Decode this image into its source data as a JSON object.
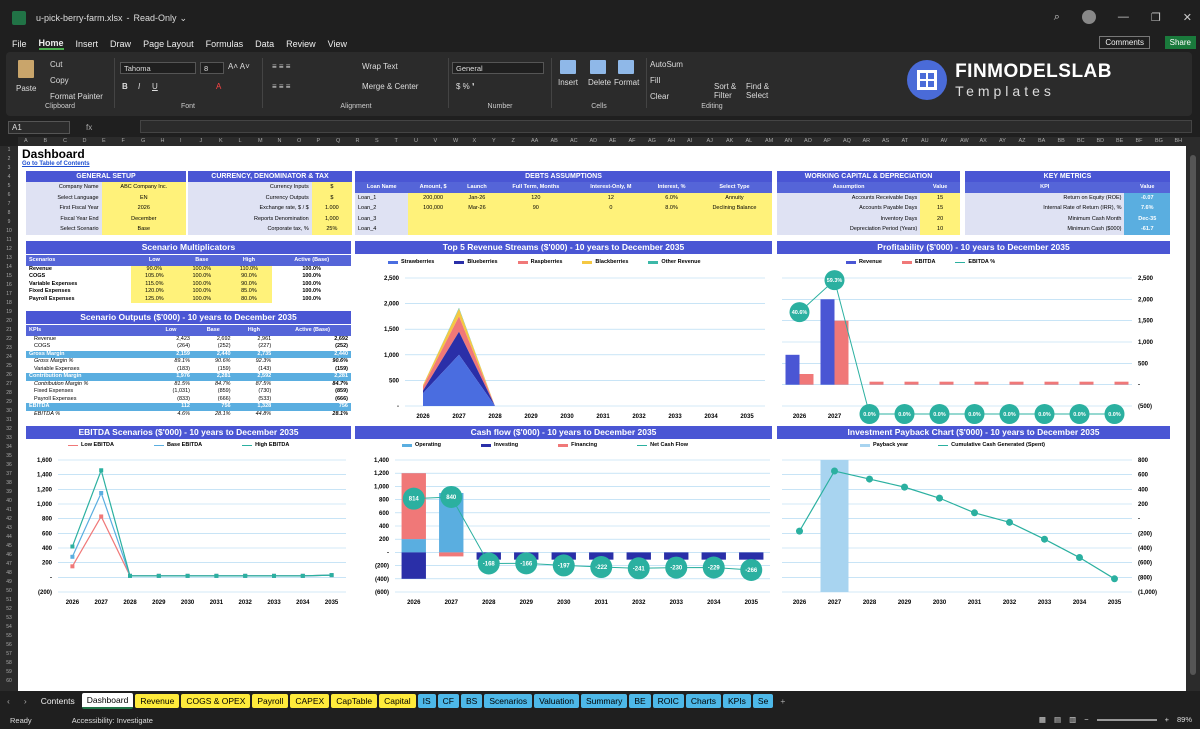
{
  "titlebar": {
    "filename": "u-pick-berry-farm.xlsx",
    "mode": "Read-Only"
  },
  "menu": {
    "items": [
      "File",
      "Home",
      "Insert",
      "Draw",
      "Page Layout",
      "Formulas",
      "Data",
      "Review",
      "View"
    ],
    "comments": "Comments",
    "share": "Share"
  },
  "ribbon": {
    "paste": "Paste",
    "cut": "Cut",
    "copy": "Copy",
    "format_painter": "Format Painter",
    "clipboard": "Clipboard",
    "font_name": "Tahoma",
    "font_size": "8",
    "font": "Font",
    "wrap": "Wrap Text",
    "merge": "Merge & Center",
    "alignment": "Alignment",
    "number_format": "General",
    "number": "Number",
    "insert": "Insert",
    "delete": "Delete",
    "format": "Format",
    "cells": "Cells",
    "autosum": "AutoSum",
    "fill": "Fill",
    "clear": "Clear",
    "sort": "Sort & Filter",
    "find": "Find & Select",
    "editing": "Editing"
  },
  "brand": {
    "name": "FINMODELSLAB",
    "sub": "Templates"
  },
  "formula": {
    "cell": "A1",
    "fx": "fx"
  },
  "columns": [
    "A",
    "B",
    "C",
    "D",
    "E",
    "F",
    "G",
    "H",
    "I",
    "J",
    "K",
    "L",
    "M",
    "N",
    "O",
    "P",
    "Q",
    "R",
    "S",
    "T",
    "U",
    "V",
    "W",
    "X",
    "Y",
    "Z",
    "AA",
    "AB",
    "AC",
    "AD",
    "AE",
    "AF",
    "AG",
    "AH",
    "AI",
    "AJ",
    "AK",
    "AL",
    "AM",
    "AN",
    "AO",
    "AP",
    "AQ",
    "AR",
    "AS",
    "AT",
    "AU",
    "AV",
    "AW",
    "AX",
    "AY",
    "AZ",
    "BA",
    "BB",
    "BC",
    "BD",
    "BE",
    "BF",
    "BG",
    "BH"
  ],
  "sheet": {
    "title": "Dashboard",
    "toc": "Go to Table of Contents"
  },
  "general": {
    "title": "GENERAL SETUP",
    "rows": [
      [
        "Company Name",
        "ABC Company Inc."
      ],
      [
        "Select Language",
        "EN"
      ],
      [
        "First Fiscal Year",
        "2026"
      ],
      [
        "Fiscal Year End",
        "December"
      ],
      [
        "Select Scenario",
        "Base"
      ]
    ]
  },
  "currency": {
    "title": "CURRENCY, DENOMINATOR & TAX",
    "rows": [
      [
        "Currency Inputs",
        "$"
      ],
      [
        "Currency Outputs",
        "$"
      ],
      [
        "Exchange rate, $ / $",
        "1.000"
      ],
      [
        "Reports Denomination",
        "1,000"
      ],
      [
        "Corporate tax, %",
        "25%"
      ]
    ]
  },
  "debts": {
    "title": "DEBTS ASSUMPTIONS",
    "head": [
      "Loan Name",
      "Amount, $",
      "Launch",
      "Full Term, Months",
      "Interest-Only, M",
      "Interest, %",
      "Select Type"
    ],
    "rows": [
      [
        "Loan_1",
        "200,000",
        "Jan-26",
        "120",
        "12",
        "6.0%",
        "Annuity"
      ],
      [
        "Loan_2",
        "100,000",
        "Mar-26",
        "90",
        "0",
        "8.0%",
        "Declining Balance"
      ],
      [
        "Loan_3",
        "",
        "",
        "",
        "",
        "",
        ""
      ],
      [
        "Loan_4",
        "",
        "",
        "",
        "",
        "",
        ""
      ]
    ]
  },
  "wc": {
    "title": "WORKING CAPITAL & DEPRECIATION",
    "head": [
      "Assumption",
      "Value"
    ],
    "rows": [
      [
        "Accounts Receivable Days",
        "15"
      ],
      [
        "Accounts Payable Days",
        "15"
      ],
      [
        "Inventory Days",
        "20"
      ],
      [
        "Depreciation Period (Years)",
        "10"
      ]
    ]
  },
  "kpi": {
    "title": "KEY METRICS",
    "head": [
      "KPI",
      "Value"
    ],
    "rows": [
      [
        "Return on Equity (ROE)",
        "-0.07"
      ],
      [
        "Internal Rate of Return (IRR), %",
        "7.6%"
      ],
      [
        "Minimum Cash Month",
        "Dec-35"
      ],
      [
        "Minimum Cash ($000)",
        "-61.7"
      ]
    ]
  },
  "mult": {
    "title": "Scenario Multiplicators",
    "head": [
      "Scenarios",
      "Low",
      "Base",
      "High",
      "Active (Base)"
    ],
    "rows": [
      [
        "Revenue",
        "90.0%",
        "100.0%",
        "110.0%",
        "100.0%"
      ],
      [
        "COGS",
        "105.0%",
        "100.0%",
        "90.0%",
        "100.0%"
      ],
      [
        "Variable Expenses",
        "115.0%",
        "100.0%",
        "90.0%",
        "100.0%"
      ],
      [
        "Fixed Expenses",
        "120.0%",
        "100.0%",
        "85.0%",
        "100.0%"
      ],
      [
        "Payroll Expenses",
        "125.0%",
        "100.0%",
        "80.0%",
        "100.0%"
      ]
    ]
  },
  "outputs": {
    "title": "Scenario Outputs ($'000) - 10 years to December 2035",
    "head": [
      "KPIs",
      "Low",
      "Base",
      "High",
      "Active (Base)"
    ],
    "rows": [
      [
        "Revenue",
        "2,423",
        "2,692",
        "2,961",
        "2,692",
        "n"
      ],
      [
        "COGS",
        "(264)",
        "(252)",
        "(227)",
        "(252)",
        "n"
      ],
      [
        "Gross Margin",
        "2,159",
        "2,440",
        "2,735",
        "2,440",
        "b"
      ],
      [
        "Gross Margin %",
        "89.1%",
        "90.6%",
        "92.3%",
        "90.6%",
        "i"
      ],
      [
        "Variable Expenses",
        "(183)",
        "(159)",
        "(143)",
        "(159)",
        "n"
      ],
      [
        "Contribution Margin",
        "1,976",
        "2,281",
        "2,592",
        "2,281",
        "b"
      ],
      [
        "Contribution Margin %",
        "81.5%",
        "84.7%",
        "87.5%",
        "84.7%",
        "i"
      ],
      [
        "Fixed Expenses",
        "(1,031)",
        "(859)",
        "(730)",
        "(859)",
        "n"
      ],
      [
        "Payroll Expenses",
        "(833)",
        "(666)",
        "(533)",
        "(666)",
        "n"
      ],
      [
        "EBITDA",
        "112",
        "756",
        "1,328",
        "756",
        "b"
      ],
      [
        "EBITDA %",
        "4.6%",
        "28.1%",
        "44.8%",
        "28.1%",
        "i"
      ]
    ]
  },
  "years": [
    "2026",
    "2027",
    "2028",
    "2029",
    "2030",
    "2031",
    "2032",
    "2033",
    "2034",
    "2035"
  ],
  "charts": {
    "revenue": {
      "title": "Top 5 Revenue Streams ($'000) - 10 years to December 2035",
      "yticks": [
        "2,500",
        "2,000",
        "1,500",
        "1,000",
        "500",
        "-"
      ],
      "series": [
        {
          "name": "Strawberries",
          "color": "#4a6de0",
          "values": [
            250,
            1000,
            0,
            0,
            0,
            0,
            0,
            0,
            0,
            0
          ]
        },
        {
          "name": "Blueberries",
          "color": "#2a2fa8",
          "values": [
            50,
            450,
            0,
            0,
            0,
            0,
            0,
            0,
            0,
            0
          ]
        },
        {
          "name": "Raspberries",
          "color": "#f07878",
          "values": [
            80,
            300,
            0,
            0,
            0,
            0,
            0,
            0,
            0,
            0
          ]
        },
        {
          "name": "Blackberries",
          "color": "#f5c842",
          "values": [
            30,
            150,
            0,
            0,
            0,
            0,
            0,
            0,
            0,
            0
          ]
        },
        {
          "name": "Other Revenue",
          "color": "#3cb8a8",
          "values": [
            0,
            20,
            0,
            0,
            0,
            0,
            0,
            0,
            0,
            0
          ]
        }
      ]
    },
    "profit": {
      "title": "Profitability ($'000) - 10 years to December 2035",
      "yticks": [
        "2,500",
        "2,000",
        "1,500",
        "1,000",
        "500",
        "-",
        "(500)"
      ],
      "revenue": [
        700,
        2000,
        0,
        0,
        0,
        0,
        0,
        0,
        0,
        0
      ],
      "ebitda": [
        250,
        1500,
        70,
        70,
        70,
        70,
        70,
        70,
        70,
        70
      ],
      "margin_labels": [
        "40.6%",
        "59.3%",
        "0.0%",
        "0.0%",
        "0.0%",
        "0.0%",
        "0.0%",
        "0.0%",
        "0.0%",
        "0.0%"
      ],
      "legend": [
        "Revenue",
        "EBITDA",
        "EBITDA %"
      ]
    },
    "ebitda": {
      "title": "EBITDA Scenarios ($'000) - 10 years to December 2035",
      "yticks": [
        "1,600",
        "1,400",
        "1,200",
        "1,000",
        "800",
        "600",
        "400",
        "200",
        "-",
        "(200)"
      ],
      "legend": [
        "Low EBITDA",
        "Base EBITDA",
        "High EBITDA"
      ],
      "low": [
        150,
        830,
        20,
        20,
        20,
        20,
        20,
        20,
        20,
        30
      ],
      "base": [
        280,
        1150,
        20,
        20,
        20,
        20,
        20,
        20,
        20,
        30
      ],
      "high": [
        420,
        1460,
        20,
        20,
        20,
        20,
        20,
        20,
        20,
        30
      ]
    },
    "cash": {
      "title": "Cash flow ($'000) - 10 years to December 2035",
      "yticks": [
        "1,400",
        "1,200",
        "1,000",
        "800",
        "600",
        "400",
        "200",
        "-",
        "(200)",
        "(400)",
        "(600)"
      ],
      "legend": [
        "Operating",
        "Investing",
        "Financing",
        "Net Cash Flow"
      ],
      "labels": [
        "814",
        "840",
        "-168",
        "-166",
        "-197",
        "-222",
        "-241",
        "-230",
        "-229",
        "-266"
      ]
    },
    "payback": {
      "title": "Investment Payback Chart ($'000) - 10 years to December 2035",
      "yticks": [
        "800",
        "600",
        "400",
        "200",
        "-",
        "(200)",
        "(400)",
        "(600)",
        "(800)",
        "(1,000)"
      ],
      "legend": [
        "Payback year",
        "Cumulative Cash Generated (Spent)"
      ],
      "values": [
        -170,
        650,
        540,
        430,
        280,
        80,
        -50,
        -280,
        -530,
        -820
      ]
    }
  },
  "tabs": [
    "Contents",
    "Dashboard",
    "Revenue",
    "COGS & OPEX",
    "Payroll",
    "CAPEX",
    "CapTable",
    "Capital",
    "IS",
    "CF",
    "BS",
    "Scenarios",
    "Valuation",
    "Summary",
    "BE",
    "ROIC",
    "Charts",
    "KPIs",
    "Se"
  ],
  "status": {
    "ready": "Ready",
    "access": "Accessibility: Investigate",
    "zoom": "89%"
  }
}
